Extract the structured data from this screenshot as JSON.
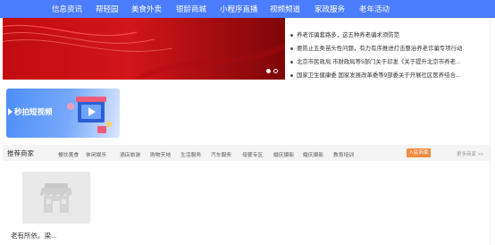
{
  "nav": {
    "items": [
      "信息资讯",
      "帮轻园",
      "美食外卖",
      "银龄商城",
      "小程序直播",
      "视频频道",
      "家政服务",
      "老年活动"
    ]
  },
  "banner": {
    "slide_count": 2,
    "active_slide": 1
  },
  "news": [
    "养老诈骗套路多，这五种养老骗术须防范",
    "要防止五类苗头性问题，有力有序推进打击整治养老诈骗专项行动",
    "北京市民政局 市财政局等5部门关于印发《关于提升北京市养老...",
    "国家卫生健康委 国家发展改革委等9部委关于开展社区医养结合..."
  ],
  "promo": {
    "label": "秒拍短视频"
  },
  "merchants": {
    "title": "推荐商家",
    "categories": [
      "餐饮美食",
      "休闲娱乐",
      "酒店旅游",
      "购物天地",
      "生活服务",
      "汽车服务",
      "母婴专区",
      "婚庆摄影",
      "婚庆摄影",
      "教育培训"
    ],
    "join_label": "入驻商家",
    "more_label": "更多商家 >>",
    "shops": [
      {
        "name": "老有所依。梁..."
      }
    ]
  },
  "colors": {
    "nav_bg": "#4a7dff",
    "banner_red": "#d2151b",
    "join_orange": "#f08a3c"
  }
}
